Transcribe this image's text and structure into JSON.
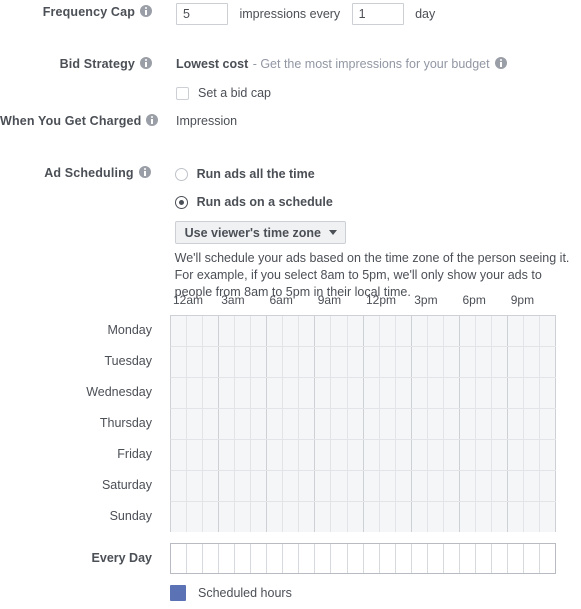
{
  "frequency_cap": {
    "label": "Frequency Cap",
    "info_icon": "info-icon",
    "impressions_value": "5",
    "middle_text": "impressions every",
    "period_value": "1",
    "period_unit": "day"
  },
  "bid_strategy": {
    "label": "Bid Strategy",
    "info_icon": "info-icon",
    "strategy_name": "Lowest cost",
    "strategy_description": "- Get the most impressions for your budget",
    "description_info_icon": "info-icon",
    "bid_cap_checkbox_label": "Set a bid cap",
    "bid_cap_checked": false
  },
  "when_charged": {
    "label": "When You Get Charged",
    "info_icon": "info-icon",
    "value": "Impression"
  },
  "ad_scheduling": {
    "label": "Ad Scheduling",
    "info_icon": "info-icon",
    "option_all_time": "Run ads all the time",
    "option_schedule": "Run ads on a schedule",
    "selected_option": "Run ads on a schedule",
    "timezone_dropdown": "Use viewer's time zone",
    "timezone_caret_icon": "chevron-down-icon",
    "helper_text": "We'll schedule your ads based on the time zone of the person seeing it. For example, if you select 8am to 5pm, we'll only show your ads to people from 8am to 5pm in their local time."
  },
  "schedule_grid": {
    "hour_labels": [
      "12am",
      "3am",
      "6am",
      "9am",
      "12pm",
      "3pm",
      "6pm",
      "9pm"
    ],
    "hours_per_day": 24,
    "days": [
      "Monday",
      "Tuesday",
      "Wednesday",
      "Thursday",
      "Friday",
      "Saturday",
      "Sunday"
    ],
    "summary_row_label": "Every Day",
    "scheduled_hours": {
      "Monday": [],
      "Tuesday": [],
      "Wednesday": [],
      "Thursday": [],
      "Friday": [],
      "Saturday": [],
      "Sunday": [],
      "Every Day": []
    },
    "colors": {
      "scheduled": "#5b73b4",
      "empty_cell": "#f5f6f7",
      "summary_cell": "#ffffff",
      "grid_line": "#e2e4e7",
      "grid_line_major": "#cdd0d4"
    }
  },
  "legend": {
    "swatch_color": "#5b73b4",
    "label": "Scheduled hours"
  }
}
